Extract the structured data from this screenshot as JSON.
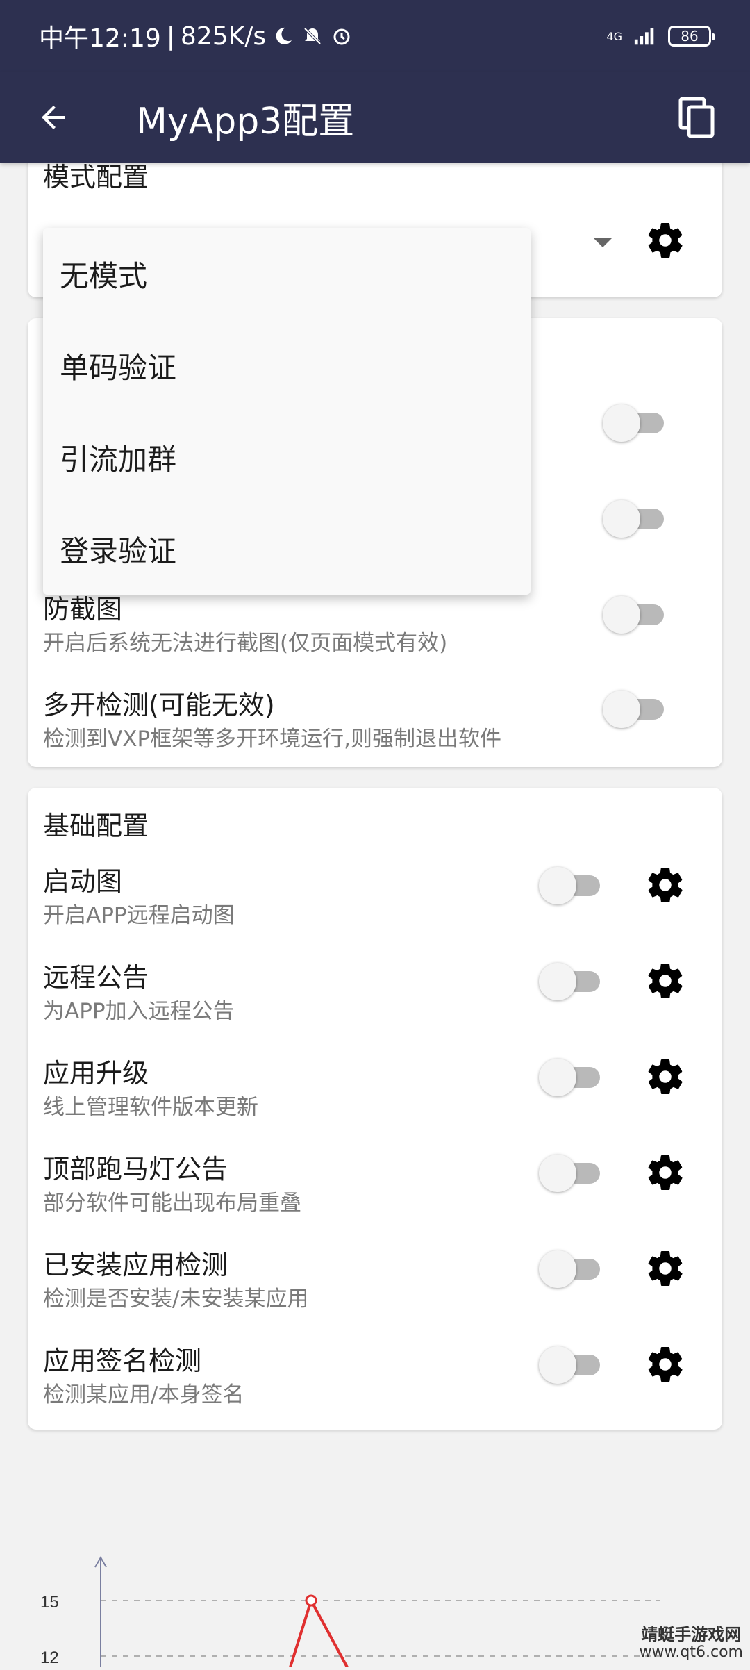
{
  "status_bar": {
    "time": "中午12:19",
    "speed": "825K/s",
    "network": "4G",
    "battery": "86"
  },
  "app_bar": {
    "title": "MyApp3配置"
  },
  "mode_card": {
    "title": "模式配置"
  },
  "dropdown": {
    "options": [
      "无模式",
      "单码验证",
      "引流加群",
      "登录验证"
    ]
  },
  "security_card": {
    "items": [
      {
        "label": "防截图",
        "desc": "开启后系统无法进行截图(仅页面模式有效)"
      },
      {
        "label": "多开检测(可能无效)",
        "desc": "检测到VXP框架等多开环境运行,则强制退出软件"
      }
    ]
  },
  "basic_card": {
    "title": "基础配置",
    "items": [
      {
        "label": "启动图",
        "desc": "开启APP远程启动图"
      },
      {
        "label": "远程公告",
        "desc": "为APP加入远程公告"
      },
      {
        "label": "应用升级",
        "desc": "线上管理软件版本更新"
      },
      {
        "label": "顶部跑马灯公告",
        "desc": "部分软件可能出现布局重叠"
      },
      {
        "label": "已安装应用检测",
        "desc": "检测是否安装/未安装某应用"
      },
      {
        "label": "应用签名检测",
        "desc": "检测某应用/本身签名"
      }
    ]
  },
  "chart_data": {
    "type": "line",
    "y_ticks": [
      "15",
      "12"
    ],
    "series_color": "#e03030"
  },
  "watermark": {
    "name": "靖蜓手游戏网",
    "url": "www.qt6.com"
  }
}
